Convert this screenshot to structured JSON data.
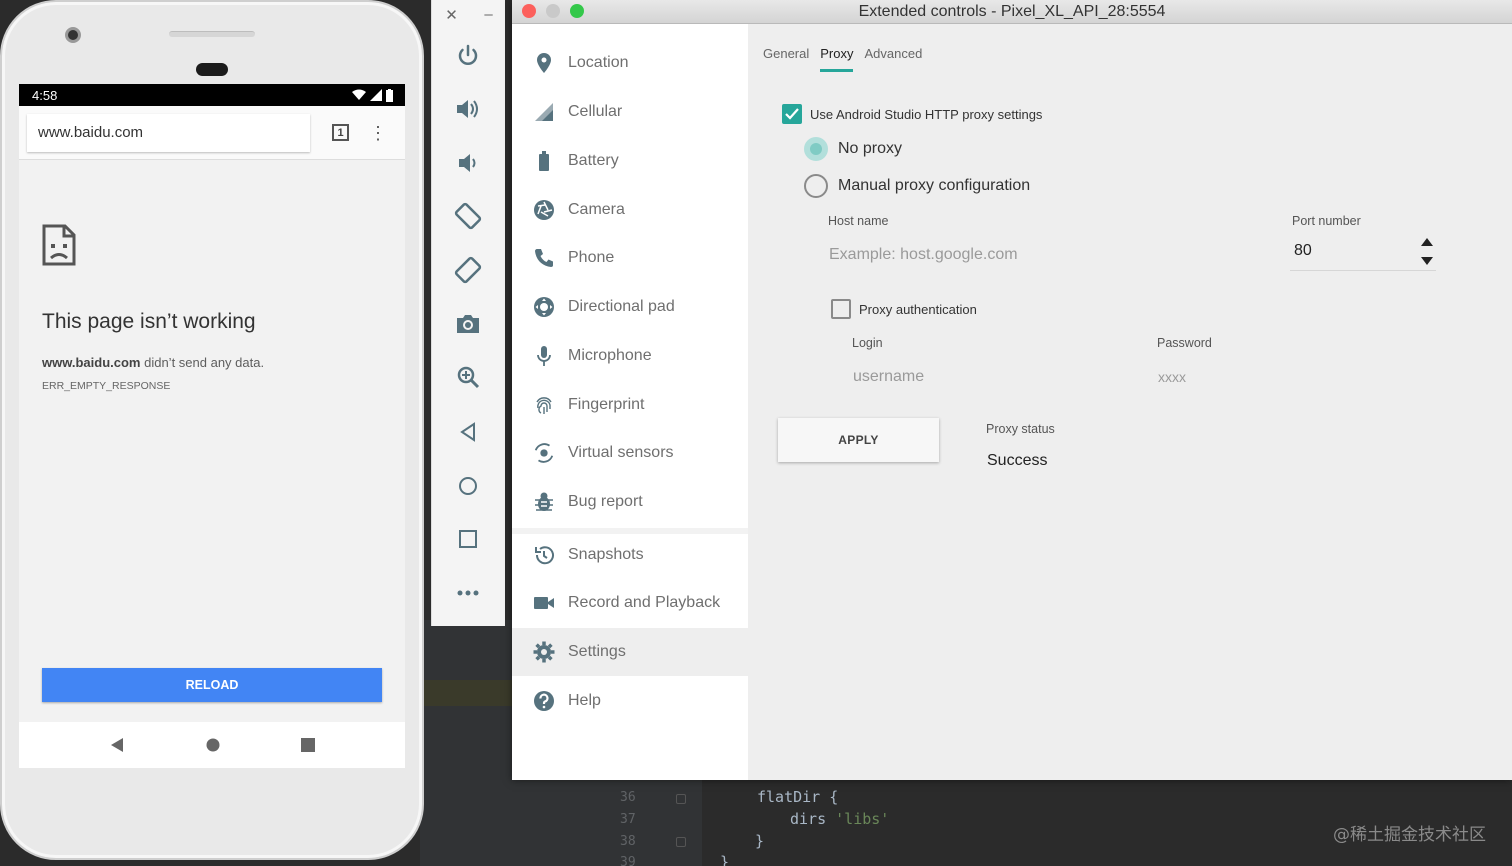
{
  "editor": {
    "lines": [
      {
        "num": "36",
        "code": "flatDir {"
      },
      {
        "num": "37",
        "code_pre": "dirs ",
        "code_str": "'libs'"
      },
      {
        "num": "38",
        "code": "}"
      },
      {
        "num": "39",
        "code": "}"
      }
    ],
    "watermark": "@稀土掘金技术社区"
  },
  "phone": {
    "status_time": "4:58",
    "url": "www.baidu.com",
    "tab_count": "1",
    "error_title": "This page isn’t working",
    "error_host": "www.baidu.com",
    "error_message": " didn’t send any data.",
    "error_code": "ERR_EMPTY_RESPONSE",
    "reload_label": "RELOAD"
  },
  "toolbar": {
    "close_glyph": "✕",
    "minimize_glyph": "–",
    "icons": [
      "power-icon",
      "volume-up-icon",
      "volume-down-icon",
      "rotate-left-icon",
      "rotate-right-icon",
      "camera-icon",
      "zoom-icon",
      "back-icon",
      "home-icon",
      "overview-icon",
      "more-icon"
    ]
  },
  "window": {
    "title": "Extended controls - Pixel_XL_API_28:5554",
    "traffic_colors": [
      "#fc605c",
      "#c9c9c9",
      "#34c84a"
    ]
  },
  "sidenav": {
    "items": [
      {
        "label": "Location",
        "icon": "location-pin-icon"
      },
      {
        "label": "Cellular",
        "icon": "cellular-icon"
      },
      {
        "label": "Battery",
        "icon": "battery-icon"
      },
      {
        "label": "Camera",
        "icon": "camera-shutter-icon"
      },
      {
        "label": "Phone",
        "icon": "phone-icon"
      },
      {
        "label": "Directional pad",
        "icon": "dpad-icon"
      },
      {
        "label": "Microphone",
        "icon": "microphone-icon"
      },
      {
        "label": "Fingerprint",
        "icon": "fingerprint-icon"
      },
      {
        "label": "Virtual sensors",
        "icon": "virtual-sensors-icon"
      },
      {
        "label": "Bug report",
        "icon": "bug-icon"
      },
      {
        "label": "Snapshots",
        "icon": "history-icon"
      },
      {
        "label": "Record and Playback",
        "icon": "videocam-icon"
      },
      {
        "label": "Settings",
        "icon": "gear-icon"
      },
      {
        "label": "Help",
        "icon": "help-icon"
      }
    ],
    "active": "Settings"
  },
  "settings": {
    "tabs": [
      "General",
      "Proxy",
      "Advanced"
    ],
    "active_tab": "Proxy",
    "use_studio_proxy": {
      "label": "Use Android Studio HTTP proxy settings",
      "checked": true
    },
    "proxy_mode": {
      "options": [
        "No proxy",
        "Manual proxy configuration"
      ],
      "selected": "No proxy"
    },
    "host_name": {
      "label": "Host name",
      "placeholder": "Example: host.google.com"
    },
    "port": {
      "label": "Port number",
      "value": "80"
    },
    "proxy_auth": {
      "label": "Proxy authentication",
      "checked": false
    },
    "login": {
      "label": "Login",
      "placeholder": "username"
    },
    "password": {
      "label": "Password",
      "placeholder": "xxxx"
    },
    "apply_label": "APPLY",
    "proxy_status": {
      "label": "Proxy status",
      "value": "Success"
    },
    "accent": "#26a69a"
  }
}
